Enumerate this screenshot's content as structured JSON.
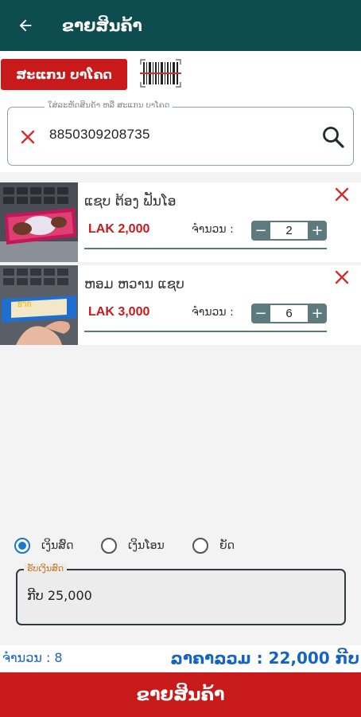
{
  "appbar": {
    "title": "ຂາຍສິນຄ້າ"
  },
  "scan": {
    "button_label": "ສະແກນ ບາໂຄດ"
  },
  "search": {
    "label": "ໃສ່ລະຫັດສິນຄ້າ ຫລື ສະແກນ ບາໂຄດ",
    "value": "8850309208735"
  },
  "cart": {
    "quantity_label": "ຈຳນວນ :",
    "items": [
      {
        "name": "ແຊບ ຕ້ອງ ຟັນໂອ",
        "price": "LAK 2,000",
        "quantity": "2"
      },
      {
        "name": "ຫອມ ຫວານ ແຊບ",
        "price": "LAK 3,000",
        "quantity": "6"
      }
    ]
  },
  "payment": {
    "options": [
      "ເງິນສົດ",
      "ເງິນໂອນ",
      "ຍັດ"
    ],
    "selected": "ເງິນສົດ",
    "cash_label": "ຮັບເງິນສົດ",
    "cash_value": "ກີບ 25,000"
  },
  "summary": {
    "quantity_text": "ຈຳນວນ : 8",
    "total_text": "ລາຄາລວມ : 22,000 ກີບ"
  },
  "sell_button_label": "ຂາຍສິນຄ້າ",
  "colors": {
    "primary_dark": "#0e4d4f",
    "accent_red": "#c81a1a",
    "total_blue": "#1565c0"
  }
}
